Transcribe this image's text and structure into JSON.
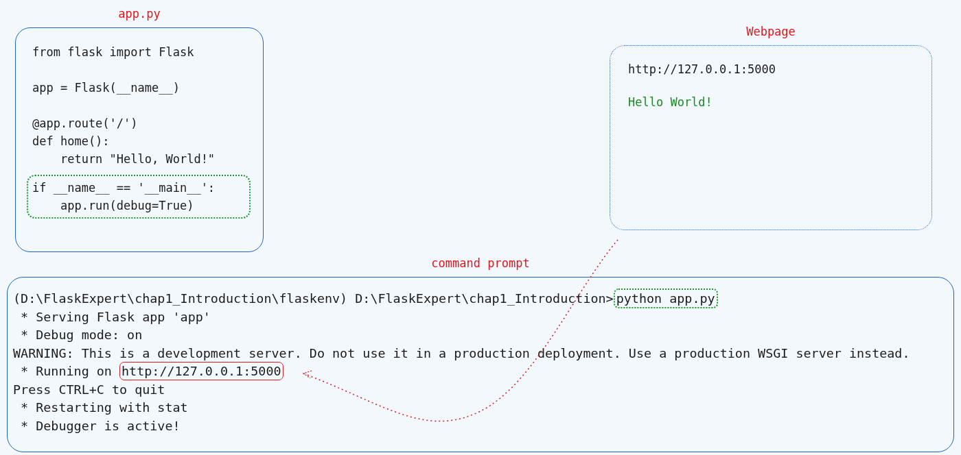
{
  "code_panel": {
    "label": "app.py",
    "blocks": [
      [
        "from flask import Flask"
      ],
      [
        "app = Flask(__name__)"
      ],
      [
        "@app.route('/')",
        "def home():",
        "    return \"Hello, World!\""
      ]
    ],
    "highlighted_lines": [
      "if __name__ == '__main__':",
      "    app.run(debug=True)"
    ]
  },
  "webpage": {
    "label": "Webpage",
    "url": "http://127.0.0.1:5000",
    "content": "Hello World!"
  },
  "terminal": {
    "label": "command prompt",
    "lines": [
      {
        "text": "(D:\\FlaskExpert\\chap1_Introduction\\flaskenv) D:\\FlaskExpert\\chap1_Introduction>",
        "highlight": "python app.py",
        "kind": "dotted"
      },
      {
        "text": " * Serving Flask app 'app'"
      },
      {
        "text": " * Debug mode: on"
      },
      {
        "text": "WARNING: This is a development server. Do not use it in a production deployment. Use a production WSGI server instead."
      },
      {
        "text": " * Running on ",
        "highlight": "http://127.0.0.1:5000",
        "kind": "solid"
      },
      {
        "text": "Press CTRL+C to quit"
      },
      {
        "text": " * Restarting with stat"
      },
      {
        "text": " * Debugger is active!"
      }
    ]
  }
}
